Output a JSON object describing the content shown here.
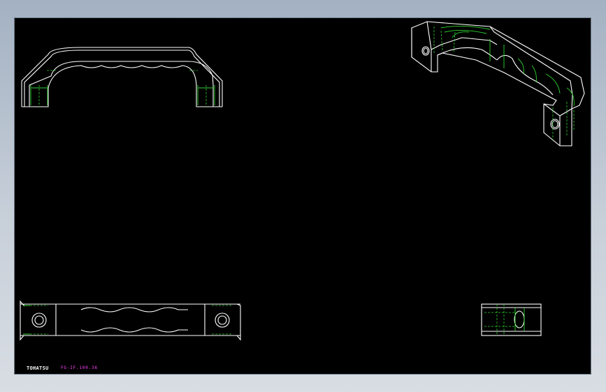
{
  "sheet": {
    "background": "#000000",
    "outline_color": "#ffffff",
    "hidden_line_color": "#2fd42f"
  },
  "views": [
    {
      "name": "front-view",
      "depicts": "handle elevation with four finger grips"
    },
    {
      "name": "isometric-view",
      "depicts": "3D handle with mounting holes"
    },
    {
      "name": "top-view",
      "depicts": "plan view with two mounting holes"
    },
    {
      "name": "side-view",
      "depicts": "end view with hole"
    }
  ],
  "title_block": {
    "logo": "TOHATSU",
    "drawing_number": "FG-IF.100.36",
    "drawing_number_color": "#ff44ff"
  }
}
